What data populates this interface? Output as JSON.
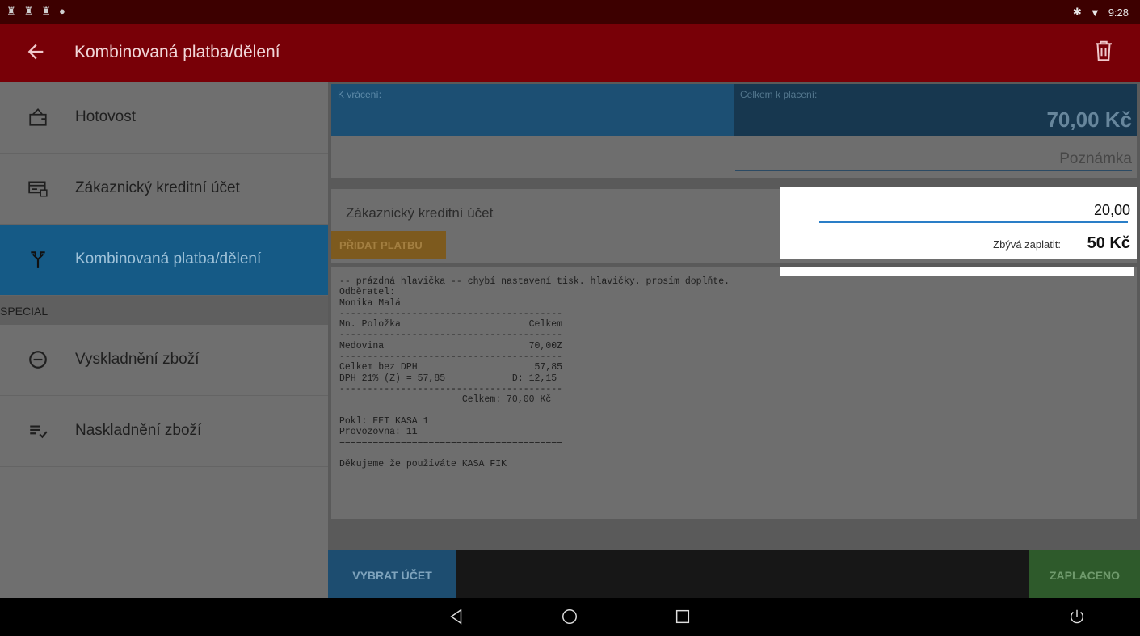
{
  "status": {
    "time": "9:28"
  },
  "appbar": {
    "title": "Kombinovaná platba/dělení"
  },
  "sidebar": {
    "items": [
      {
        "label": "Hotovost"
      },
      {
        "label": "Zákaznický kreditní účet"
      },
      {
        "label": "Kombinovaná platba/dělení"
      }
    ],
    "section": "SPECIAL",
    "special_items": [
      {
        "label": "Vyskladnění zboží"
      },
      {
        "label": "Naskladnění zboží"
      }
    ]
  },
  "summary": {
    "k_vraceni_label": "K vrácení:",
    "celkem_label": "Celkem k placení:",
    "celkem_value": "70,00 Kč",
    "poznamka_placeholder": "Poznámka"
  },
  "payment": {
    "method_label": "Zákaznický kreditní účet",
    "add_button": "PŘIDAT PLATBU",
    "amount": "20,00",
    "remain_label": "Zbývá zaplatit:",
    "remain_value": "50 Kč"
  },
  "receipt": {
    "text": "-- prázdná hlavička -- chybí nastavení tisk. hlavičky. prosím doplňte.\nOdběratel:\nMonika Malá\n----------------------------------------\nMn. Položka                       Celkem\n----------------------------------------\nMedovina                          70,00Z\n----------------------------------------\nCelkem bez DPH                     57,85\nDPH 21% (Z) = 57,85            D: 12,15\n----------------------------------------\n                      Celkem: 70,00 Kč\n\nPokl: EET KASA 1\nProvozovna: 11\n========================================\n\nDěkujeme že používáte KASA FIK"
  },
  "footer": {
    "vybrat_ucet": "VYBRAT ÚČET",
    "zaplaceno": "ZAPLACENO"
  }
}
